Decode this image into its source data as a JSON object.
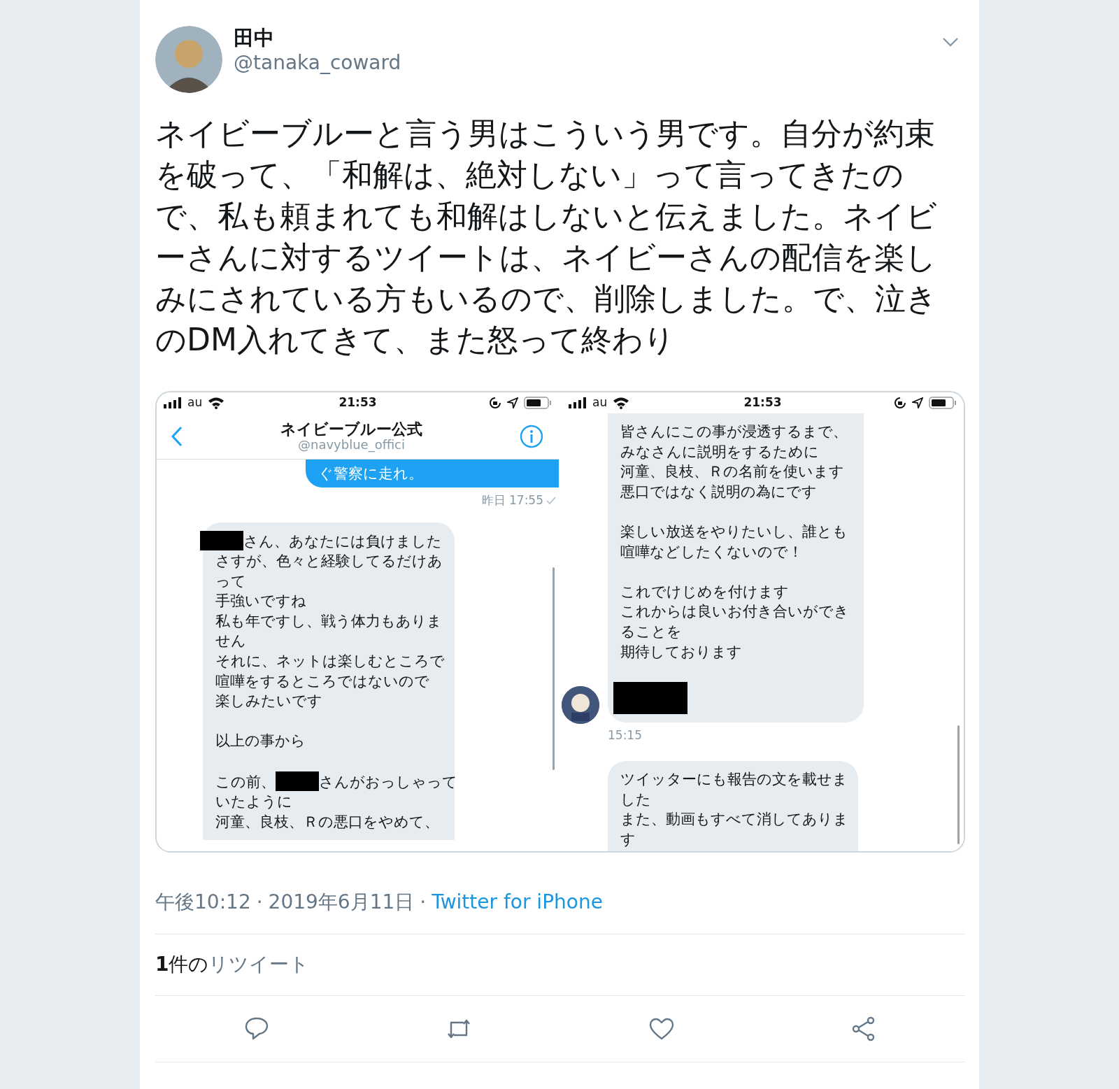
{
  "author": {
    "name": "田中",
    "handle": "@tanaka_coward"
  },
  "tweet_text": "ネイビーブルーと言う男はこういう男です。自分が約束を破って、「和解は、絶対しない」って言ってきたので、私も頼まれても和解はしないと伝えました。ネイビーさんに対するツイートは、ネイビーさんの配信を楽しみにされている方もいるので、削除しました。で、泣きのDM入れてきて、また怒って終わり",
  "media": [
    {
      "status": {
        "carrier": "au",
        "time": "21:53"
      },
      "header": {
        "title": "ネイビーブルー公式",
        "handle": "@navyblue_offici"
      },
      "messages": [
        {
          "kind": "sent",
          "cut_top": true,
          "cut_bottom": false,
          "avatar": false,
          "read": true,
          "time": "昨日 17:55",
          "paragraphs": [
            [
              [
                {
                  "kind": "text",
                  "text": "ぐ警察に走れ。"
                }
              ]
            ]
          ]
        },
        {
          "kind": "received",
          "cut_top": false,
          "cut_bottom": true,
          "avatar": false,
          "paragraphs": [
            [
              [
                {
                  "kind": "redaction"
                },
                {
                  "kind": "text",
                  "text": "さん、あなたには負けました"
                }
              ],
              [
                {
                  "kind": "text",
                  "text": "さすが、色々と経験してるだけあ"
                }
              ],
              [
                {
                  "kind": "text",
                  "text": "って"
                }
              ],
              [
                {
                  "kind": "text",
                  "text": "手強いですね"
                }
              ],
              [
                {
                  "kind": "text",
                  "text": "私も年ですし、戦う体力もありま"
                }
              ],
              [
                {
                  "kind": "text",
                  "text": "せん"
                }
              ],
              [
                {
                  "kind": "text",
                  "text": "それに、ネットは楽しむところで"
                }
              ],
              [
                {
                  "kind": "text",
                  "text": "喧嘩をするところではないので"
                }
              ],
              [
                {
                  "kind": "text",
                  "text": "楽しみたいです"
                }
              ]
            ],
            [
              [
                {
                  "kind": "text",
                  "text": "以上の事から"
                }
              ]
            ],
            [
              [
                {
                  "kind": "text",
                  "text": "この前、"
                },
                {
                  "kind": "redaction"
                },
                {
                  "kind": "text",
                  "text": "さんがおっしゃって"
                }
              ],
              [
                {
                  "kind": "text",
                  "text": "いたように"
                }
              ],
              [
                {
                  "kind": "text",
                  "text": "河童、良枝、Ｒの悪口をやめて、"
                }
              ]
            ]
          ]
        }
      ]
    },
    {
      "status": {
        "carrier": "au",
        "time": "21:53"
      },
      "messages": [
        {
          "kind": "received",
          "cut_top": true,
          "cut_bottom": false,
          "avatar": true,
          "read": false,
          "time": "15:15",
          "paragraphs": [
            [
              [
                {
                  "kind": "text",
                  "text": "皆さんにこの事が浸透するまで、"
                }
              ],
              [
                {
                  "kind": "text",
                  "text": "みなさんに説明をするために"
                }
              ],
              [
                {
                  "kind": "text",
                  "text": "河童、良枝、Ｒの名前を使います"
                }
              ],
              [
                {
                  "kind": "text",
                  "text": "悪口ではなく説明の為にです"
                }
              ]
            ],
            [
              [
                {
                  "kind": "text",
                  "text": "楽しい放送をやりたいし、誰とも"
                }
              ],
              [
                {
                  "kind": "text",
                  "text": "喧嘩などしたくないので！"
                }
              ]
            ],
            [
              [
                {
                  "kind": "text",
                  "text": "これでけじめを付けます"
                }
              ],
              [
                {
                  "kind": "text",
                  "text": "これからは良いお付き合いができ"
                }
              ],
              [
                {
                  "kind": "text",
                  "text": "ることを"
                }
              ],
              [
                {
                  "kind": "text",
                  "text": "期待しております"
                }
              ]
            ],
            [
              [
                {
                  "kind": "redaction"
                }
              ]
            ]
          ]
        },
        {
          "kind": "received",
          "cut_top": false,
          "cut_bottom": true,
          "avatar": false,
          "paragraphs": [
            [
              [
                {
                  "kind": "text",
                  "text": "ツイッターにも報告の文を載せま"
                }
              ],
              [
                {
                  "kind": "text",
                  "text": "した"
                }
              ],
              [
                {
                  "kind": "text",
                  "text": "また、動画もすべて消してありま"
                }
              ],
              [
                {
                  "kind": "text",
                  "text": "す"
                }
              ]
            ]
          ]
        }
      ]
    }
  ],
  "meta": [
    {
      "kind": "text",
      "text": "午後10:12"
    },
    {
      "kind": "separator",
      "text": "·"
    },
    {
      "kind": "text",
      "text": "2019年6月11日"
    },
    {
      "kind": "separator",
      "text": "·"
    },
    {
      "kind": "link",
      "text": "Twitter for iPhone"
    }
  ],
  "retweets": {
    "count": "**1**件の",
    "label": "リツイート"
  }
}
